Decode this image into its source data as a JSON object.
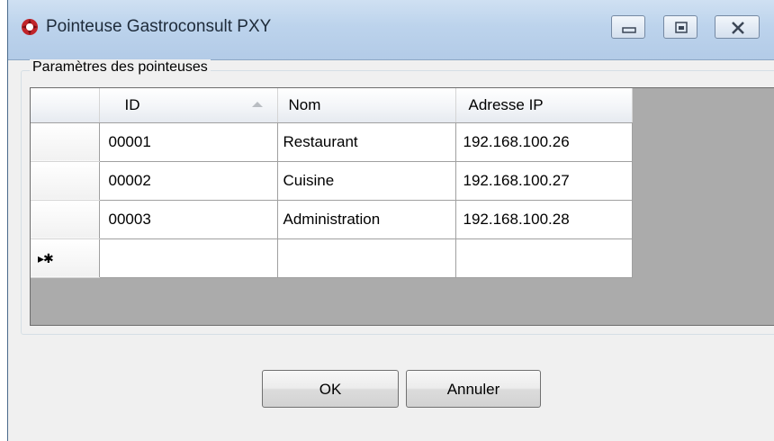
{
  "window": {
    "title": "Pointeuse Gastroconsult PXY",
    "controls": {
      "minimize_icon": "minimize-icon",
      "maximize_icon": "maximize-icon",
      "close_icon": "close-icon"
    }
  },
  "group": {
    "label": "Paramètres des pointeuses"
  },
  "grid": {
    "columns": [
      "ID",
      "Nom",
      "Adresse IP"
    ],
    "sorted_column": "ID",
    "sort_direction": "ascending",
    "rows": [
      {
        "id": "00001",
        "nom": "Restaurant",
        "ip": "192.168.100.26"
      },
      {
        "id": "00002",
        "nom": "Cuisine",
        "ip": "192.168.100.27"
      },
      {
        "id": "00003",
        "nom": "Administration",
        "ip": "192.168.100.28"
      }
    ],
    "new_row_marker": "▸✱"
  },
  "buttons": {
    "ok": "OK",
    "cancel": "Annuler"
  },
  "colors": {
    "titlebar": "#bcd3ec",
    "grid_background": "#ababab",
    "window_background": "#f0f0f0"
  }
}
